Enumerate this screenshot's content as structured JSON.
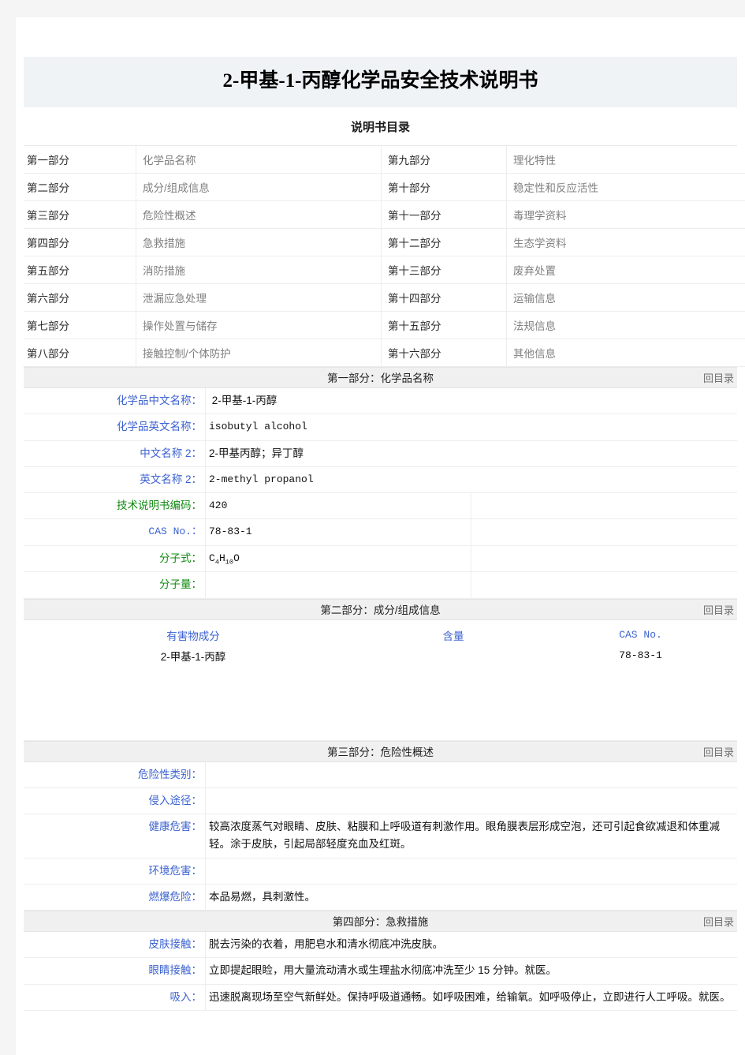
{
  "document": {
    "title_prefix_num1": "2",
    "title": "2-甲基-1-丙醇化学品安全技术说明书",
    "toc_heading": "说明书目录",
    "back_to_toc_label": "回目录"
  },
  "toc": {
    "rows": [
      {
        "left_no": "第一部分",
        "left_name": "化学品名称",
        "right_no": "第九部分",
        "right_name": "理化特性"
      },
      {
        "left_no": "第二部分",
        "left_name": "成分/组成信息",
        "right_no": "第十部分",
        "right_name": "稳定性和反应活性"
      },
      {
        "left_no": "第三部分",
        "left_name": "危险性概述",
        "right_no": "第十一部分",
        "right_name": "毒理学资料"
      },
      {
        "left_no": "第四部分",
        "left_name": "急救措施",
        "right_no": "第十二部分",
        "right_name": "生态学资料"
      },
      {
        "left_no": "第五部分",
        "left_name": "消防措施",
        "right_no": "第十三部分",
        "right_name": "废弃处置"
      },
      {
        "left_no": "第六部分",
        "left_name": "泄漏应急处理",
        "right_no": "第十四部分",
        "right_name": "运输信息"
      },
      {
        "left_no": "第七部分",
        "left_name": "操作处置与储存",
        "right_no": "第十五部分",
        "right_name": "法规信息"
      },
      {
        "left_no": "第八部分",
        "left_name": "接触控制/个体防护",
        "right_no": "第十六部分",
        "right_name": "其他信息"
      }
    ]
  },
  "section1": {
    "header": "第一部分：化学品名称",
    "fields": [
      {
        "label": "化学品中文名称：",
        "value": "2-甲基-1-丙醇"
      },
      {
        "label": "化学品英文名称：",
        "value": "isobutyl alcohol"
      },
      {
        "label": "中文名称 2：",
        "value": "2-甲基丙醇；异丁醇"
      },
      {
        "label": "英文名称 2：",
        "value": "2-methyl propanol"
      },
      {
        "label": "技术说明书编码：",
        "value": "420"
      },
      {
        "label": "CAS No.：",
        "value": "78-83-1"
      },
      {
        "label": "分子式：",
        "value": "C4H10O"
      },
      {
        "label": "分子量：",
        "value": ""
      }
    ]
  },
  "section2": {
    "header": "第二部分：成分/组成信息",
    "columns": {
      "component": "有害物成分",
      "content": "含量",
      "cas": "CAS No."
    },
    "rows": [
      {
        "component": "2-甲基-1-丙醇",
        "content": "",
        "cas": "78-83-1"
      }
    ]
  },
  "section3": {
    "header": "第三部分：危险性概述",
    "fields": [
      {
        "label": "危险性类别：",
        "value": ""
      },
      {
        "label": "侵入途径：",
        "value": ""
      },
      {
        "label": "健康危害：",
        "value": "较高浓度蒸气对眼睛、皮肤、粘膜和上呼吸道有刺激作用。眼角膜表层形成空泡，还可引起食欲减退和体重减轻。涂于皮肤，引起局部轻度充血及红斑。"
      },
      {
        "label": "环境危害：",
        "value": ""
      },
      {
        "label": "燃爆危险：",
        "value": "本品易燃，具刺激性。"
      }
    ]
  },
  "section4": {
    "header": "第四部分：急救措施",
    "fields": [
      {
        "label": "皮肤接触：",
        "value": "脱去污染的衣着，用肥皂水和清水彻底冲洗皮肤。"
      },
      {
        "label": "眼睛接触：",
        "value": "立即提起眼睑，用大量流动清水或生理盐水彻底冲洗至少 15 分钟。就医。"
      },
      {
        "label": "吸入：",
        "value": "迅速脱离现场至空气新鲜处。保持呼吸道通畅。如呼吸困难，给输氧。如呼吸停止，立即进行人工呼吸。就医。"
      }
    ]
  },
  "colors": {
    "label_blue": "#3b62d0",
    "label_green": "#108a10",
    "section_bar_bg": "#f0f0f0",
    "title_bg": "#eff3f5",
    "page_bg": "#f5f5f5"
  }
}
